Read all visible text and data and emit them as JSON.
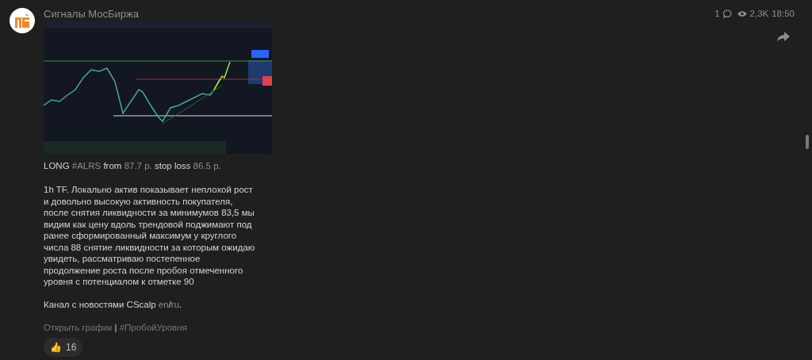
{
  "channel": {
    "name": "Сигналы МосБиржа"
  },
  "meta": {
    "comments": "1",
    "views": "2,3K",
    "time": "18:50"
  },
  "message": {
    "headline": [
      {
        "kind": "plain",
        "text": "LONG "
      },
      {
        "kind": "link",
        "text": "#ALRS"
      },
      {
        "kind": "plain",
        "text": " from "
      },
      {
        "kind": "link",
        "text": "87.7 p."
      },
      {
        "kind": "plain",
        "text": " stop loss "
      },
      {
        "kind": "link",
        "text": "86.5 p."
      }
    ],
    "body_lines": [
      "1h TF. Локально актив показывает неплохой рост",
      "и довольно высокую активность покупателя,",
      "после снятия ликвидности за минимумов 83,5 мы",
      "видим как цену вдоль трендовой поджимают под",
      "ранее сформированный максимум у круглого",
      "числа 88 снятие ликвидности за которым ожидаю",
      "увидеть, рассматриваю постепенное",
      "продолжение роста после пробоя отмеченного",
      "уровня с потенциалом к отметке 90"
    ],
    "news": [
      {
        "kind": "plain",
        "text": "Канал с новостями CScalp "
      },
      {
        "kind": "link",
        "text": "en"
      },
      {
        "kind": "plain",
        "text": "/"
      },
      {
        "kind": "link",
        "text": "ru"
      },
      {
        "kind": "plain",
        "text": "."
      }
    ],
    "footer": [
      {
        "kind": "link",
        "text": "Открыть график"
      },
      {
        "kind": "plain",
        "text": " | "
      },
      {
        "kind": "link",
        "text": "#ПробойУровня"
      }
    ],
    "reactions": [
      {
        "emoji": "👍",
        "count": "16"
      }
    ]
  }
}
